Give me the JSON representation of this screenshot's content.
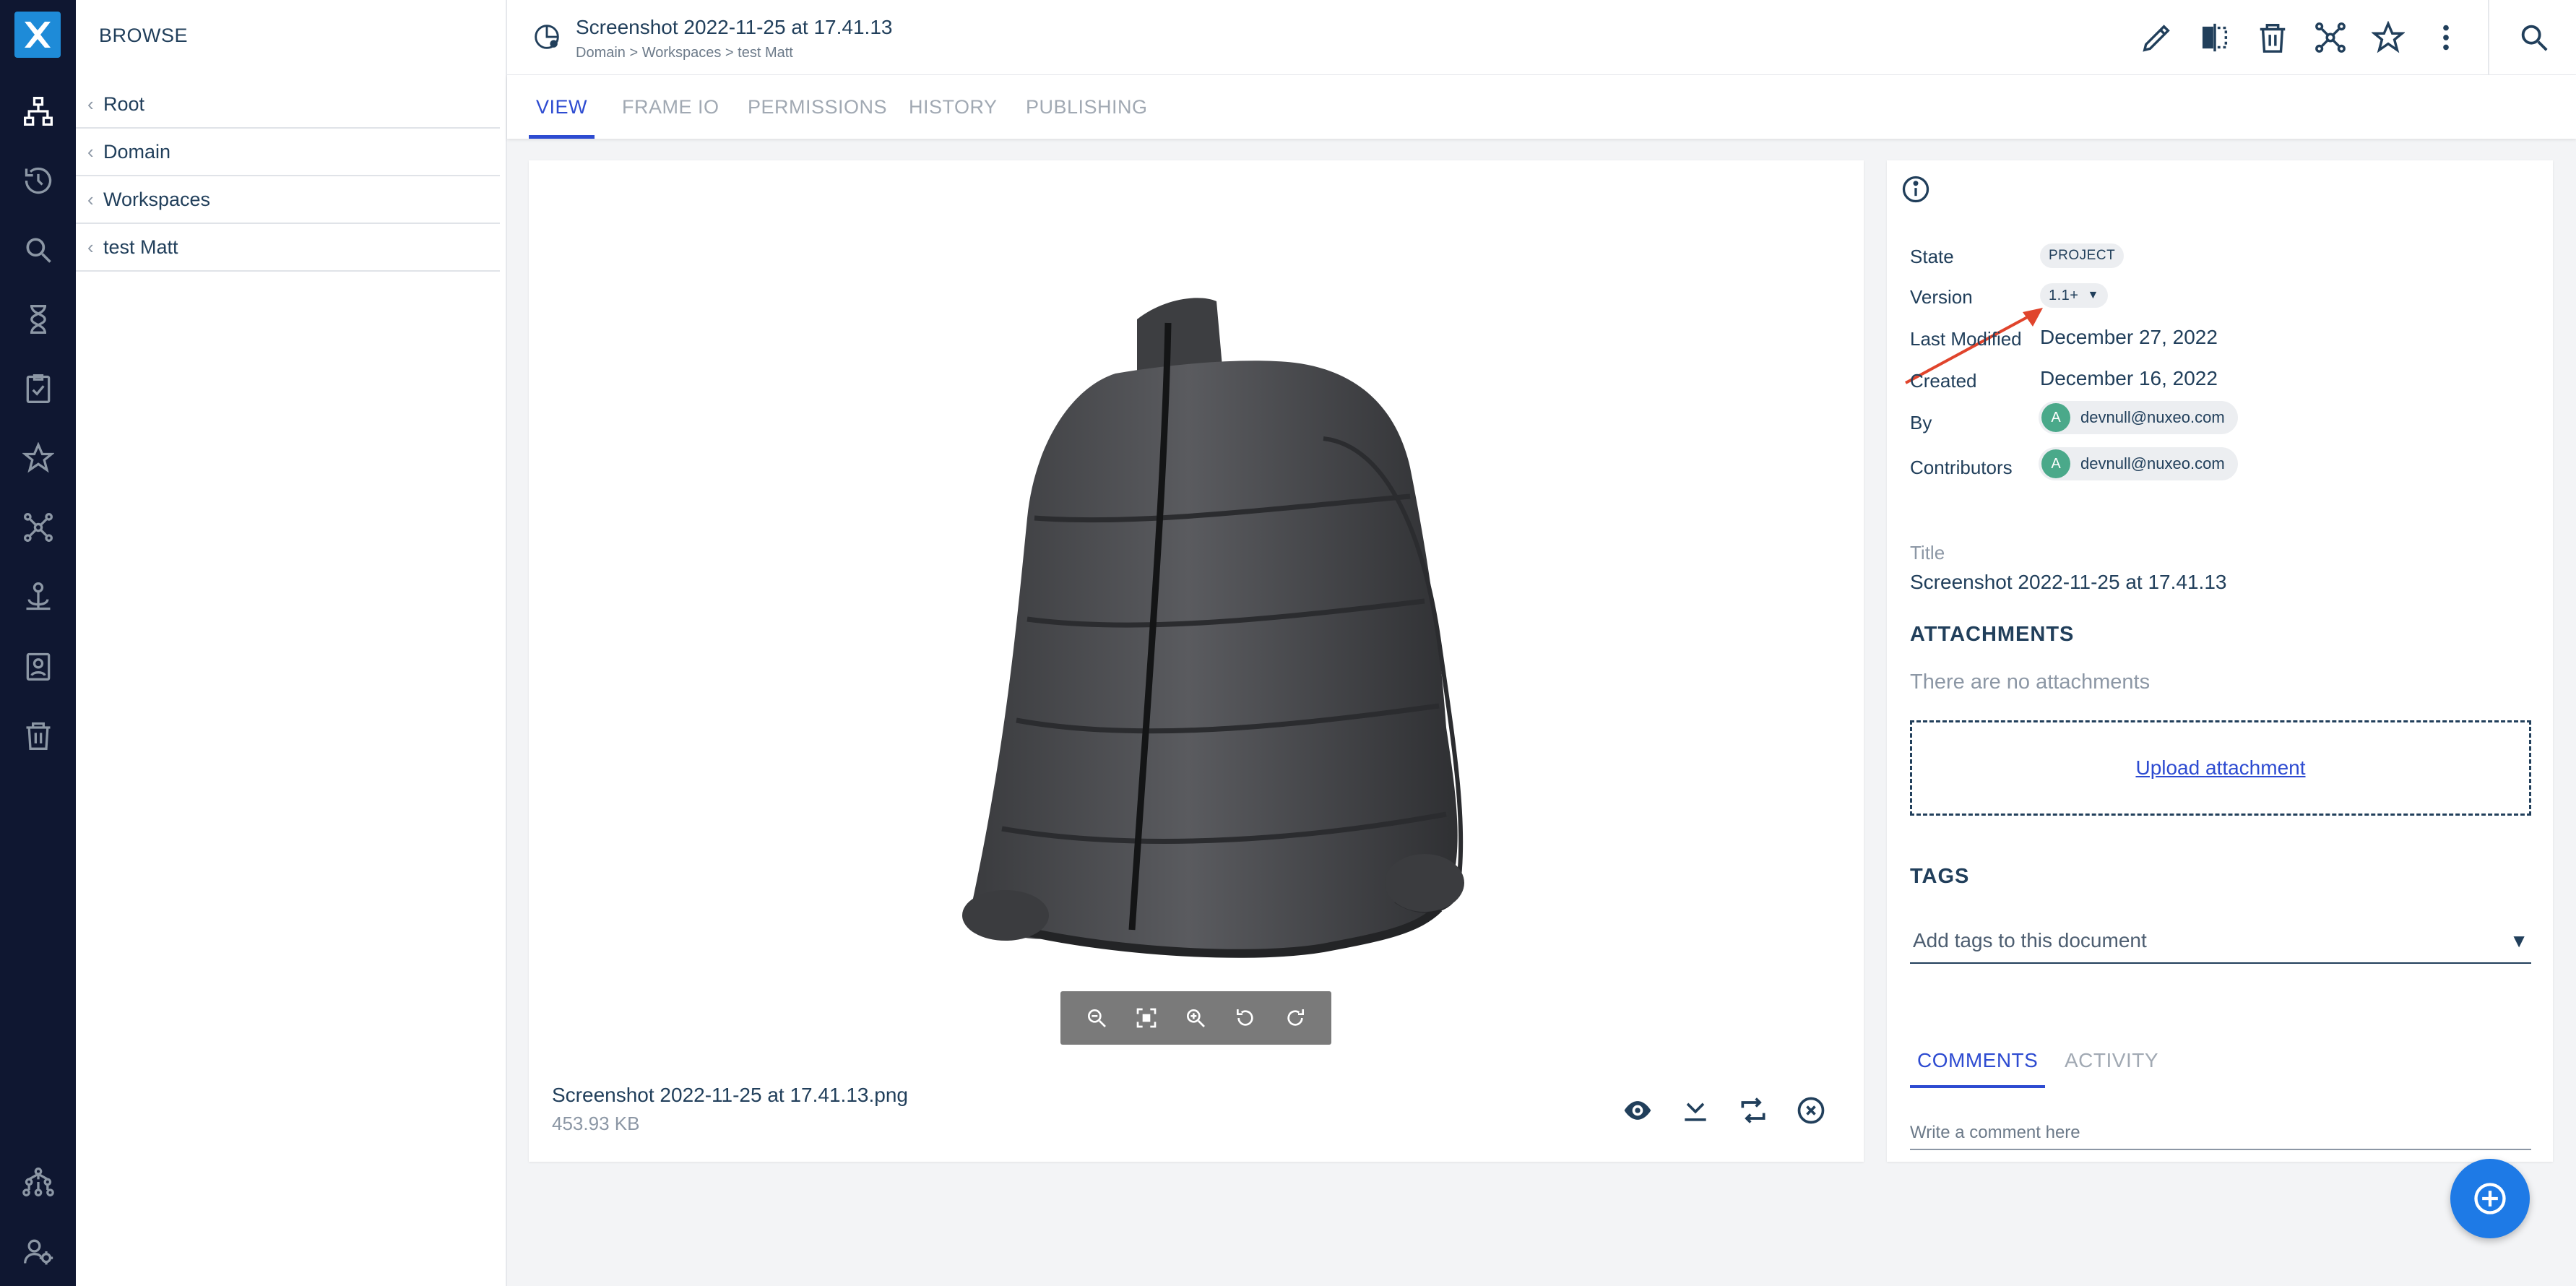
{
  "drawer": {
    "title": "BROWSE",
    "crumbs": [
      "Root",
      "Domain",
      "Workspaces",
      "test Matt"
    ]
  },
  "document": {
    "title": "Screenshot 2022-11-25 at 17.41.13",
    "breadcrumb": "Domain > Workspaces > test Matt"
  },
  "tabs": [
    "VIEW",
    "FRAME IO",
    "PERMISSIONS",
    "HISTORY",
    "PUBLISHING"
  ],
  "viewer": {
    "file_name": "Screenshot 2022-11-25 at 17.41.13.png",
    "file_size": "453.93 KB"
  },
  "meta": {
    "state_label": "State",
    "state_value": "PROJECT",
    "version_label": "Version",
    "version_value": "1.1+",
    "last_modified_label": "Last Modified",
    "last_modified_value": "December 27, 2022",
    "created_label": "Created",
    "created_value": "December 16, 2022",
    "by_label": "By",
    "by_avatar": "A",
    "by_value": "devnull@nuxeo.com",
    "contributors_label": "Contributors",
    "contributors_avatar": "A",
    "contributors_value": "devnull@nuxeo.com",
    "title_label": "Title",
    "title_value": "Screenshot 2022-11-25 at 17.41.13",
    "attachments_heading": "ATTACHMENTS",
    "attachments_empty": "There are no attachments",
    "upload_label": "Upload attachment",
    "tags_heading": "TAGS",
    "tags_placeholder": "Add tags to this document",
    "tags_arrow": "▼",
    "comments_tab": "COMMENTS",
    "activity_tab": "ACTIVITY",
    "comment_placeholder": "Write a comment here"
  },
  "colors": {
    "rail": "#0f1731",
    "accent": "#2d4bd1",
    "fab": "#1e7ae6",
    "annotation_arrow": "#e0442c"
  }
}
